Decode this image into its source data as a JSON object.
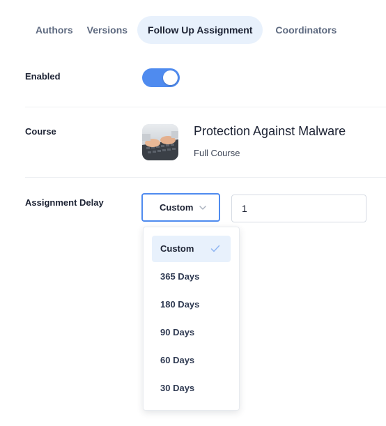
{
  "tabs": [
    {
      "label": "Authors",
      "active": false
    },
    {
      "label": "Versions",
      "active": false
    },
    {
      "label": "Follow Up Assignment",
      "active": true
    },
    {
      "label": "Coordinators",
      "active": false
    }
  ],
  "enabled": {
    "label": "Enabled",
    "value": true
  },
  "course": {
    "label": "Course",
    "title": "Protection Against Malware",
    "subtitle": "Full Course",
    "thumbnail_icon": "keyboard-typing-photo"
  },
  "assignment_delay": {
    "label": "Assignment Delay",
    "selected": "Custom",
    "custom_value": "1",
    "options": [
      "Custom",
      "365 Days",
      "180 Days",
      "90 Days",
      "60 Days",
      "30 Days"
    ]
  },
  "colors": {
    "accent": "#4f8bef",
    "active_tab_bg": "#e8f1fc"
  }
}
